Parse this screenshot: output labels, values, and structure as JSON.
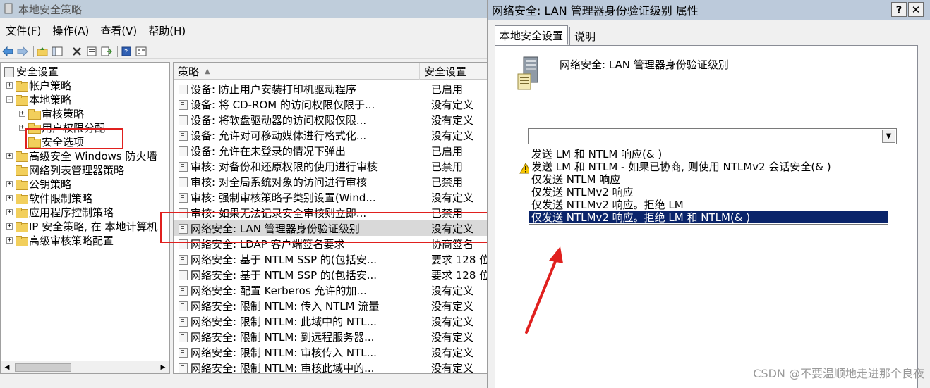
{
  "main": {
    "title": "本地安全策略",
    "menu": [
      "文件(F)",
      "操作(A)",
      "查看(V)",
      "帮助(H)"
    ],
    "tree": {
      "items": [
        {
          "label": "安全设置",
          "level": 0,
          "expander": ""
        },
        {
          "label": "帐户策略",
          "level": 1,
          "expander": "+"
        },
        {
          "label": "本地策略",
          "level": 1,
          "expander": "-"
        },
        {
          "label": "审核策略",
          "level": 2,
          "expander": "+"
        },
        {
          "label": "用户权限分配",
          "level": 2,
          "expander": "+"
        },
        {
          "label": "安全选项",
          "level": 2,
          "expander": ""
        },
        {
          "label": "高级安全 Windows 防火墙",
          "level": 1,
          "expander": "+"
        },
        {
          "label": "网络列表管理器策略",
          "level": 1,
          "expander": ""
        },
        {
          "label": "公钥策略",
          "level": 1,
          "expander": "+"
        },
        {
          "label": "软件限制策略",
          "level": 1,
          "expander": "+"
        },
        {
          "label": "应用程序控制策略",
          "level": 1,
          "expander": "+"
        },
        {
          "label": "IP 安全策略, 在 本地计算机",
          "level": 1,
          "expander": "+"
        },
        {
          "label": "高级审核策略配置",
          "level": 1,
          "expander": "+"
        }
      ]
    },
    "list": {
      "col_policy": "策略",
      "col_setting": "安全设置",
      "sort_indicator": "▲",
      "rows": [
        {
          "policy": "设备: 防止用户安装打印机驱动程序",
          "setting": "已启用"
        },
        {
          "policy": "设备: 将 CD-ROM 的访问权限仅限于...",
          "setting": "没有定义"
        },
        {
          "policy": "设备: 将软盘驱动器的访问权限仅限...",
          "setting": "没有定义"
        },
        {
          "policy": "设备: 允许对可移动媒体进行格式化...",
          "setting": "没有定义"
        },
        {
          "policy": "设备: 允许在未登录的情况下弹出",
          "setting": "已启用"
        },
        {
          "policy": "审核: 对备份和还原权限的使用进行审核",
          "setting": "已禁用"
        },
        {
          "policy": "审核: 对全局系统对象的访问进行审核",
          "setting": "已禁用"
        },
        {
          "policy": "审核: 强制审核策略子类别设置(Wind...",
          "setting": "没有定义"
        },
        {
          "policy": "审核: 如果无法记录安全审核则立即...",
          "setting": "已禁用"
        },
        {
          "policy": "网络安全: LAN 管理器身份验证级别",
          "setting": "没有定义"
        },
        {
          "policy": "网络安全: LDAP 客户端签名要求",
          "setting": "协商签名"
        },
        {
          "policy": "网络安全: 基于 NTLM SSP 的(包括安...",
          "setting": "要求 128 位"
        },
        {
          "policy": "网络安全: 基于 NTLM SSP 的(包括安...",
          "setting": "要求 128 位"
        },
        {
          "policy": "网络安全: 配置 Kerberos 允许的加...",
          "setting": "没有定义"
        },
        {
          "policy": "网络安全: 限制 NTLM: 传入 NTLM 流量",
          "setting": "没有定义"
        },
        {
          "policy": "网络安全: 限制 NTLM: 此域中的 NTL...",
          "setting": "没有定义"
        },
        {
          "policy": "网络安全: 限制 NTLM: 到远程服务器...",
          "setting": "没有定义"
        },
        {
          "policy": "网络安全: 限制 NTLM: 审核传入 NTL...",
          "setting": "没有定义"
        },
        {
          "policy": "网络安全: 限制 NTLM: 审核此域中的...",
          "setting": "没有定义"
        }
      ]
    }
  },
  "dialog": {
    "title": "网络安全: LAN 管理器身份验证级别 属性",
    "help_button": "?",
    "close_button": "✕",
    "tabs": [
      "本地安全设置",
      "说明"
    ],
    "policy_name": "网络安全: LAN 管理器身份验证级别",
    "dropdown_value": "",
    "options": [
      "发送 LM 和 NTLM 响应(& )",
      "发送 LM 和 NTLM - 如果已协商, 则使用 NTLMv2 会话安全(& )",
      "仅发送 NTLM 响应",
      "仅发送 NTLMv2 响应",
      "仅发送 NTLMv2 响应。拒绝 LM",
      "仅发送 NTLMv2 响应。拒绝 LM 和 NTLM(& )"
    ],
    "selected_option_index": 5
  },
  "watermark": "CSDN @不要温顺地走进那个良夜",
  "colors": {
    "selection": "#0a246a",
    "annotation": "#e0201e"
  }
}
